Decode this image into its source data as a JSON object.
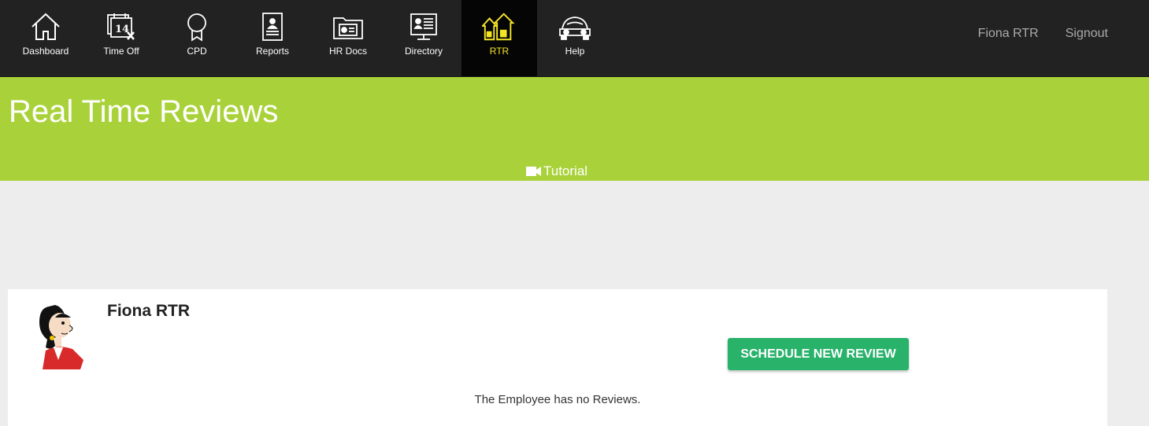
{
  "nav": {
    "items": [
      {
        "label": "Dashboard",
        "icon": "home-icon"
      },
      {
        "label": "Time Off",
        "icon": "calendar-icon",
        "calendar_day": "14"
      },
      {
        "label": "CPD",
        "icon": "award-ribbon-icon"
      },
      {
        "label": "Reports",
        "icon": "report-document-icon"
      },
      {
        "label": "HR Docs",
        "icon": "folder-id-icon"
      },
      {
        "label": "Directory",
        "icon": "directory-monitor-icon"
      },
      {
        "label": "RTR",
        "icon": "rtr-arrows-icon",
        "active": true
      },
      {
        "label": "Help",
        "icon": "car-icon"
      }
    ],
    "user": "Fiona RTR",
    "signout": "Signout"
  },
  "banner": {
    "title": "Real Time Reviews",
    "tutorial": "Tutorial",
    "tutorial_icon": "video-camera-icon"
  },
  "employee": {
    "name": "Fiona RTR",
    "avatar": "cartoon-avatar",
    "schedule_button": "SCHEDULE NEW REVIEW",
    "empty_message": "The Employee has no Reviews."
  },
  "colors": {
    "navbar": "#222222",
    "active_nav": "#050505",
    "active_text": "#f5e625",
    "banner": "#a9d23a",
    "button": "#28b26a",
    "background": "#ededed"
  }
}
